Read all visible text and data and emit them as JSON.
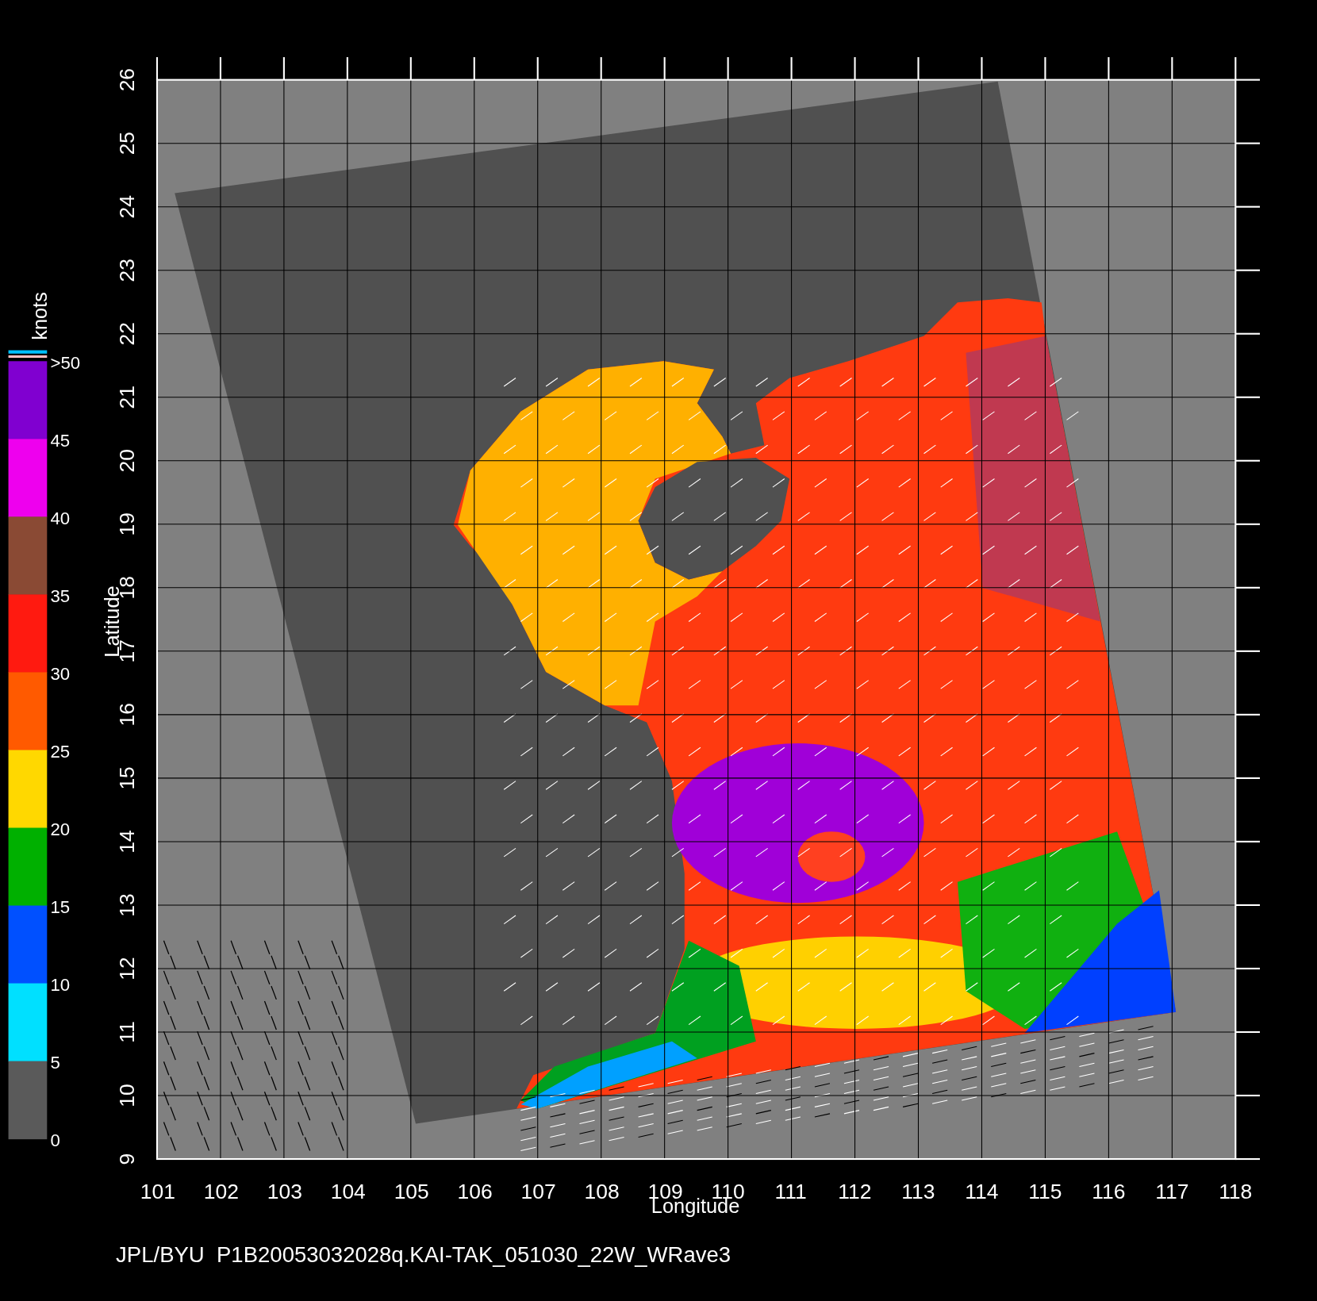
{
  "plot": {
    "xlabel": "Longitude",
    "ylabel": "Latitude",
    "xticks": [
      "101",
      "102",
      "103",
      "104",
      "105",
      "106",
      "107",
      "108",
      "109",
      "110",
      "111",
      "112",
      "113",
      "114",
      "115",
      "116",
      "117",
      "118"
    ],
    "yticks": [
      "9",
      "10",
      "11",
      "12",
      "13",
      "14",
      "15",
      "16",
      "17",
      "18",
      "19",
      "20",
      "21",
      "22",
      "23",
      "24",
      "25",
      "26"
    ]
  },
  "colorbar": {
    "title": "knots",
    "segments": [
      {
        "color": "#8000d0"
      },
      {
        "color": "#ee00ee"
      },
      {
        "color": "#8a4a34"
      },
      {
        "color": "#ff1a10"
      },
      {
        "color": "#ff5a00"
      },
      {
        "color": "#ffd800"
      },
      {
        "color": "#00b000"
      },
      {
        "color": "#0050ff"
      },
      {
        "color": "#00e0ff"
      },
      {
        "color": "#5a5a5a"
      }
    ],
    "labels": [
      ">50",
      "45",
      "40",
      "35",
      "30",
      "25",
      "20",
      "15",
      "10",
      "5",
      "0"
    ]
  },
  "caption": "JPL/BYU  P1B20053032028q.KAI-TAK_051030_22W_WRave3"
}
